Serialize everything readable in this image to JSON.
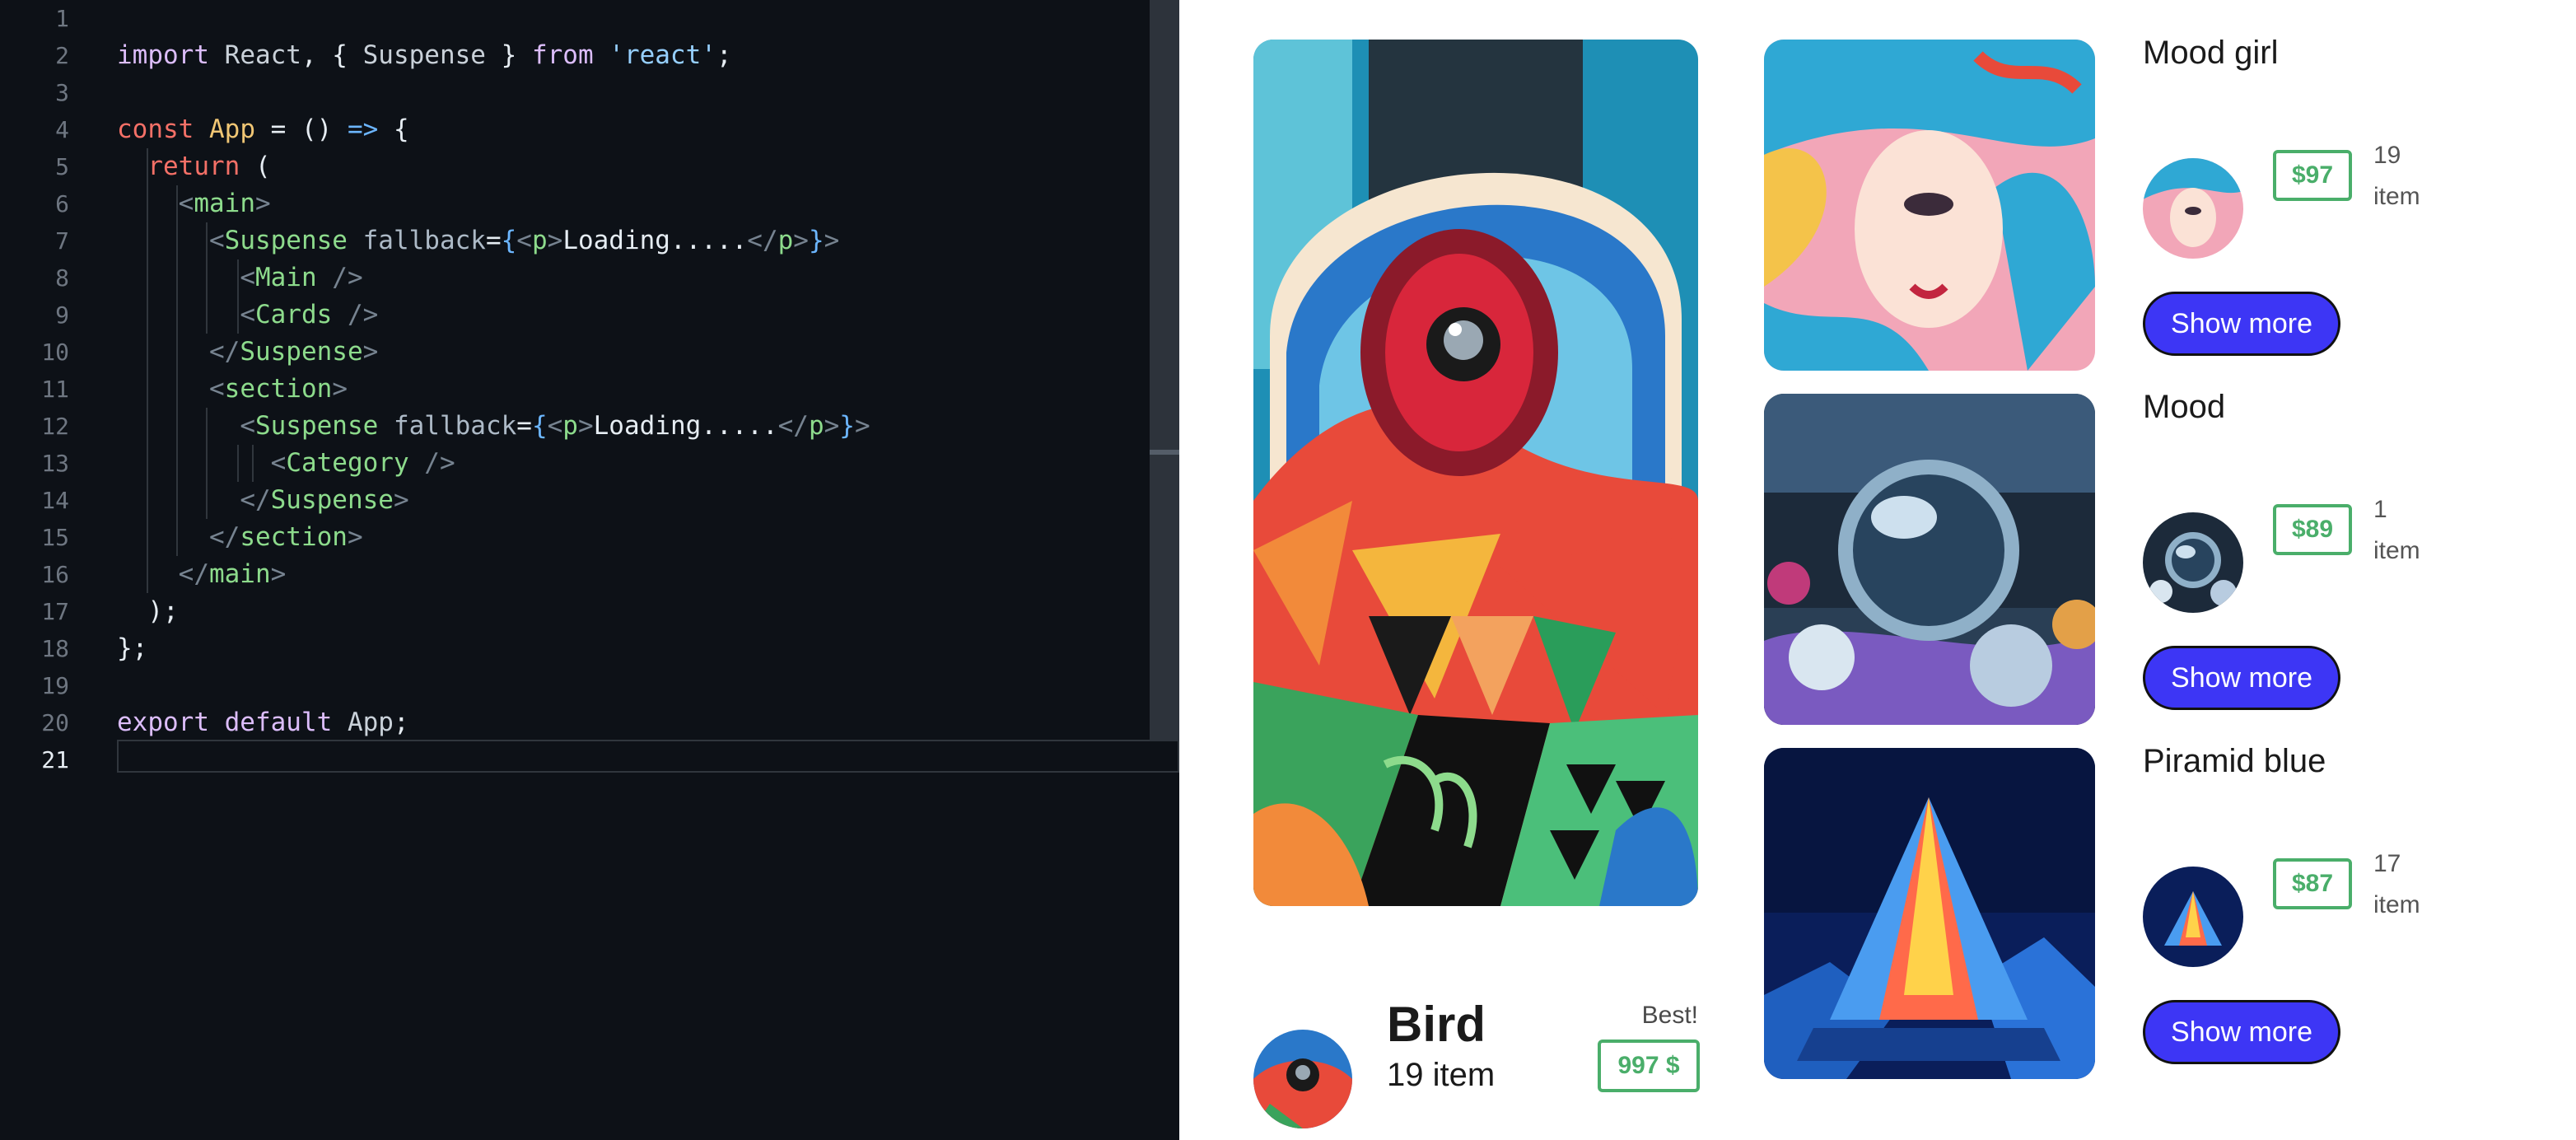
{
  "editor": {
    "line_numbers": [
      "1",
      "2",
      "3",
      "4",
      "5",
      "6",
      "7",
      "8",
      "9",
      "10",
      "11",
      "12",
      "13",
      "14",
      "15",
      "16",
      "17",
      "18",
      "19",
      "20",
      "21"
    ],
    "current_line": "21",
    "code": {
      "l2": {
        "import": "import",
        "react": "React",
        "comma": ", { ",
        "suspense": "Suspense",
        "close": " } ",
        "from": "from",
        "str": "'react'",
        "semi": ";"
      },
      "l4": {
        "const": "const",
        "app": "App",
        "eq": " = () ",
        "arrow": "=>",
        "open": " {"
      },
      "l5": {
        "return": "return",
        "paren": " ("
      },
      "l6": {
        "lt": "<",
        "tag": "main",
        "gt": ">"
      },
      "l7": {
        "lt": "<",
        "tag": "Suspense",
        "attr": " fallback",
        "eq": "=",
        "ob": "{",
        "plt": "<",
        "p": "p",
        "pgt": ">",
        "text": "Loading.....",
        "clt": "</",
        "cp": "p",
        "cgt": ">",
        "cb": "}",
        "gt": ">"
      },
      "l8": {
        "lt": "<",
        "tag": "Main",
        "end": " />"
      },
      "l9": {
        "lt": "<",
        "tag": "Cards",
        "end": " />"
      },
      "l10": {
        "lt": "</",
        "tag": "Suspense",
        "gt": ">"
      },
      "l11": {
        "lt": "<",
        "tag": "section",
        "gt": ">"
      },
      "l12": {
        "lt": "<",
        "tag": "Suspense",
        "attr": " fallback",
        "eq": "=",
        "ob": "{",
        "plt": "<",
        "p": "p",
        "pgt": ">",
        "text": "Loading.....",
        "clt": "</",
        "cp": "p",
        "cgt": ">",
        "cb": "}",
        "gt": ">"
      },
      "l13": {
        "lt": "<",
        "tag": "Category",
        "end": " />"
      },
      "l14": {
        "lt": "</",
        "tag": "Suspense",
        "gt": ">"
      },
      "l15": {
        "lt": "</",
        "tag": "section",
        "gt": ">"
      },
      "l16": {
        "lt": "</",
        "tag": "main",
        "gt": ">"
      },
      "l17": {
        "text": ");"
      },
      "l18": {
        "text": "};"
      },
      "l20": {
        "export": "export",
        "default": " default ",
        "app": "App",
        "semi": ";"
      }
    }
  },
  "preview": {
    "hero": {
      "title": "Bird",
      "count": "19 item",
      "badge_label": "Best!",
      "price": "997 $",
      "image": "abstract-bird-painting",
      "avatar": "bird-avatar"
    },
    "cards": [
      {
        "title": "Mood girl",
        "price": "$97",
        "count": "19 item",
        "button": "Show more",
        "image": "watercolor-girl-painting"
      },
      {
        "title": "Mood",
        "price": "$89",
        "count": "1 item",
        "button": "Show more",
        "image": "crystal-ball-photo"
      },
      {
        "title": "Piramid blue",
        "price": "$87",
        "count": "17 item",
        "button": "Show more",
        "image": "blue-pyramid-photo"
      }
    ]
  },
  "colors": {
    "editor_bg": "#0d1117",
    "accent_button": "#3d36f5",
    "price_green": "#4aae6a"
  }
}
